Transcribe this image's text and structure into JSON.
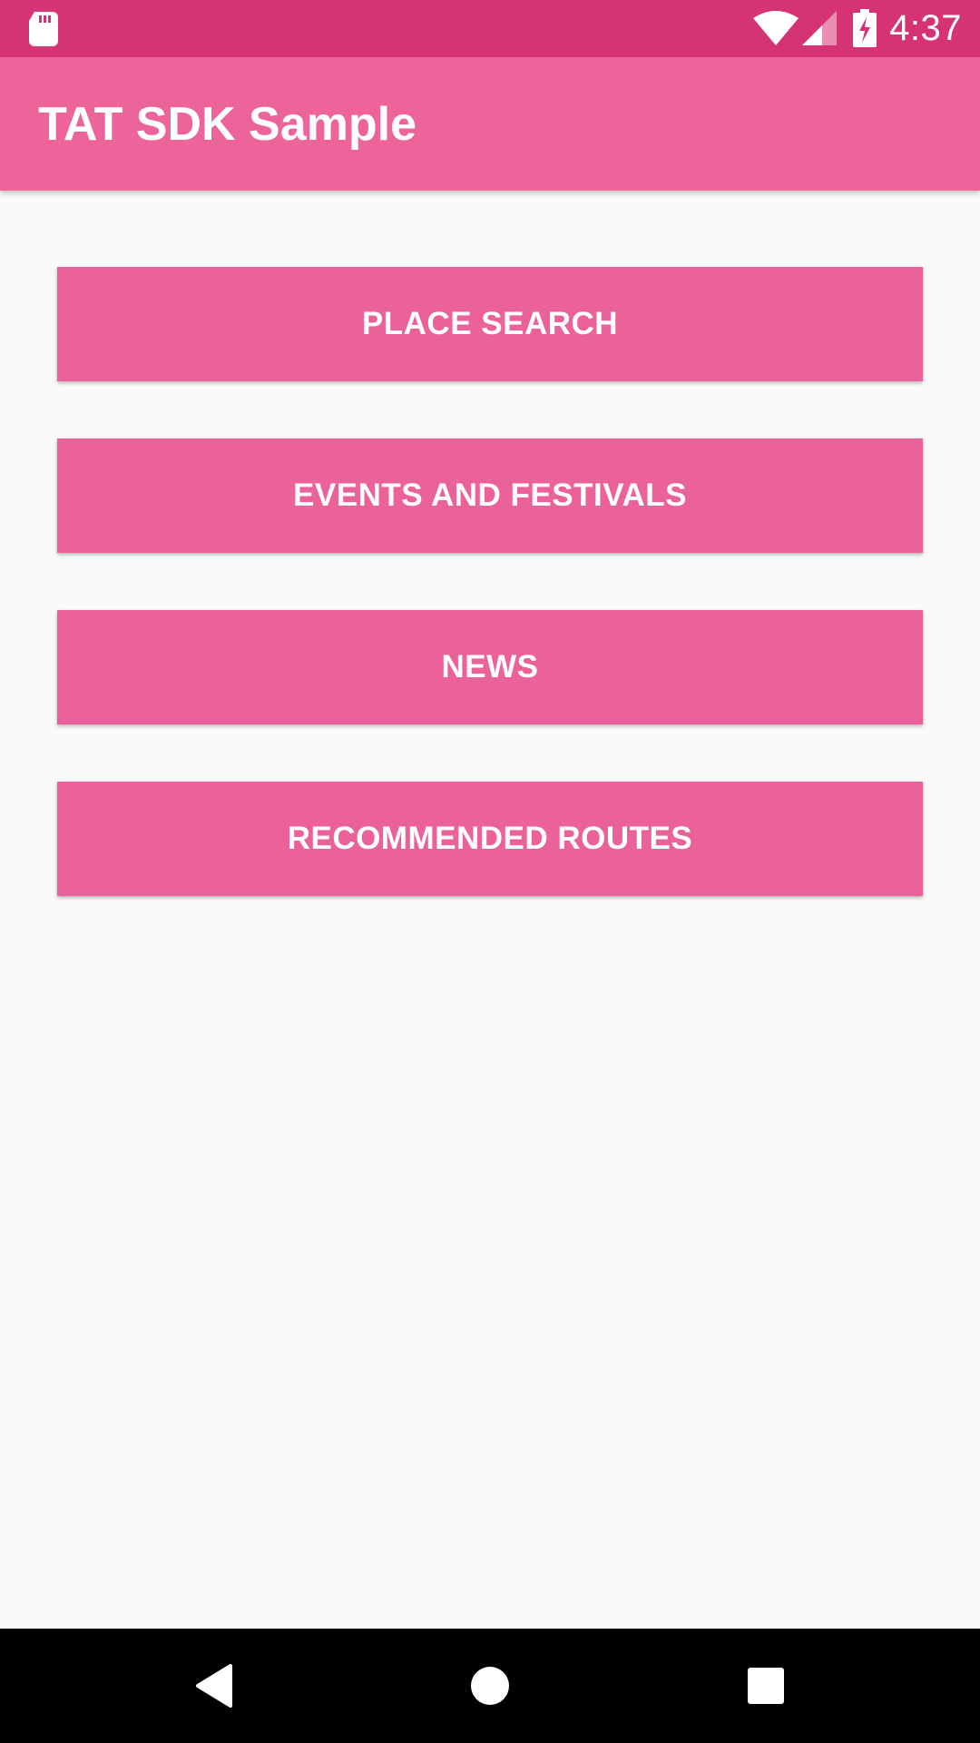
{
  "status_bar": {
    "time": "4:37",
    "icons": [
      "sd-card-icon",
      "wifi-icon",
      "cell-signal-icon",
      "battery-charging-icon"
    ]
  },
  "app_bar": {
    "title": "TAT SDK Sample"
  },
  "buttons": [
    {
      "label": "PLACE SEARCH"
    },
    {
      "label": "EVENTS AND FESTIVALS"
    },
    {
      "label": "NEWS"
    },
    {
      "label": "RECOMMENDED ROUTES"
    }
  ],
  "nav_bar": {
    "icons": [
      "back-icon",
      "home-icon",
      "recents-icon"
    ]
  },
  "colors": {
    "status_bar": "#d63374",
    "app_bar": "#ec6499",
    "button": "#ea6299",
    "background": "#fafafa",
    "nav_bar": "#000000"
  }
}
